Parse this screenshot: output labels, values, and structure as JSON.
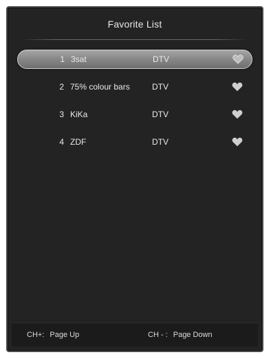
{
  "dialog": {
    "title": "Favorite List"
  },
  "channels": [
    {
      "number": "1",
      "name": "3sat",
      "type": "DTV",
      "favorite": true,
      "selected": true,
      "icon": "heart-icon"
    },
    {
      "number": "2",
      "name": "75% colour bars",
      "type": "DTV",
      "favorite": true,
      "selected": false,
      "icon": "heart-icon"
    },
    {
      "number": "3",
      "name": "KiKa",
      "type": "DTV",
      "favorite": true,
      "selected": false,
      "icon": "heart-icon"
    },
    {
      "number": "4",
      "name": "ZDF",
      "type": "DTV",
      "favorite": true,
      "selected": false,
      "icon": "heart-icon"
    }
  ],
  "footer": {
    "page_up_key": "CH+:",
    "page_up_label": "Page Up",
    "page_down_key": "CH - :",
    "page_down_label": "Page Down"
  },
  "colors": {
    "background": "#232323",
    "selected_row": "#8a8a8a",
    "text": "#eaeaea",
    "heart": "#cfcfcf"
  }
}
